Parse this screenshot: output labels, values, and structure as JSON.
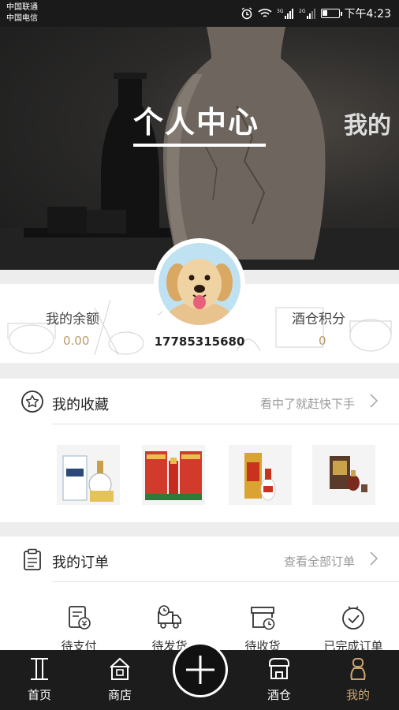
{
  "status_bar": {
    "carrier1": "中国联通",
    "carrier2": "中国电信",
    "time": "下午4:23",
    "icons": [
      "alarm-icon",
      "wifi-icon",
      "signal-3g-icon",
      "signal-2g-icon",
      "battery-icon"
    ]
  },
  "hero": {
    "title": "个人中心",
    "next_title": "我的"
  },
  "profile": {
    "balance_label": "我的余额",
    "balance_value": "0.00",
    "phone": "17785315680",
    "points_label": "酒仓积分",
    "points_value": "0"
  },
  "favorites": {
    "title": "我的收藏",
    "hint": "看中了就赶快下手",
    "icon": "star-icon",
    "products": [
      {
        "name": "product-1"
      },
      {
        "name": "product-2"
      },
      {
        "name": "product-3"
      },
      {
        "name": "product-4"
      }
    ]
  },
  "orders": {
    "title": "我的订单",
    "hint": "查看全部订单",
    "icon": "clipboard-icon",
    "items": [
      {
        "label": "待支付",
        "icon": "pay-icon"
      },
      {
        "label": "待发货",
        "icon": "truck-icon"
      },
      {
        "label": "待收货",
        "icon": "box-clock-icon"
      },
      {
        "label": "已完成订单",
        "icon": "check-icon"
      }
    ]
  },
  "tabbar": {
    "items": [
      {
        "label": "首页",
        "icon": "home-i-icon"
      },
      {
        "label": "商店",
        "icon": "store-icon"
      },
      {
        "label": "酒仓",
        "icon": "warehouse-icon"
      },
      {
        "label": "我的",
        "icon": "user-icon"
      }
    ],
    "active_color": "#c9a56c",
    "fab_icon": "plus-icon"
  }
}
